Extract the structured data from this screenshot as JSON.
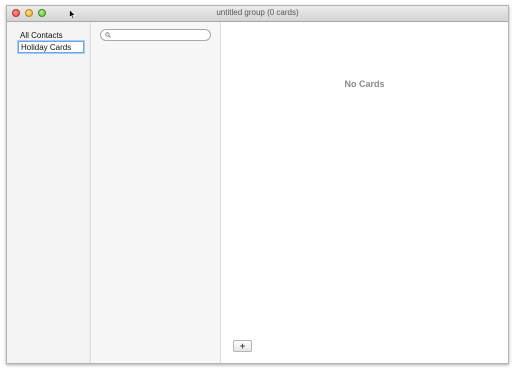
{
  "window": {
    "title": "untitled group (0 cards)"
  },
  "groups": {
    "all_contacts": "All Contacts",
    "editing_group_value": "Holiday Cards"
  },
  "search": {
    "placeholder": "",
    "icon": "magnifying-glass-icon"
  },
  "detail": {
    "empty_text": "No Cards",
    "add_label": "+"
  },
  "colors": {
    "close": "#e0443b",
    "minimize": "#e5a823",
    "zoom": "#5fb63a",
    "focus_ring": "#6da6e8"
  }
}
